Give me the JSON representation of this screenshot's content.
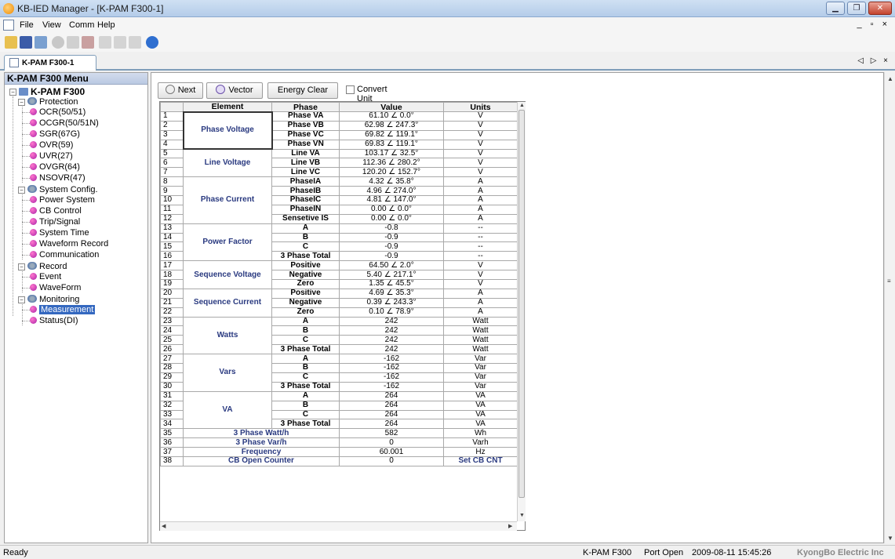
{
  "window": {
    "title": "KB-IED Manager - [K-PAM F300-1]"
  },
  "menu": {
    "items": [
      "File",
      "View",
      "Comm",
      "Help"
    ]
  },
  "tab": {
    "label": "K-PAM F300-1"
  },
  "left": {
    "header": "K-PAM F300 Menu",
    "root": "K-PAM F300",
    "groups": [
      {
        "label": "Protection",
        "items": [
          "OCR(50/51)",
          "OCGR(50/51N)",
          "SGR(67G)",
          "OVR(59)",
          "UVR(27)",
          "OVGR(64)",
          "NSOVR(47)"
        ]
      },
      {
        "label": "System Config.",
        "items": [
          "Power System",
          "CB Control",
          "Trip/Signal",
          "System Time",
          "Waveform Record",
          "Communication"
        ]
      },
      {
        "label": "Record",
        "items": [
          "Event",
          "WaveForm"
        ]
      },
      {
        "label": "Monitoring",
        "items": [
          "Measurement",
          "Status(DI)"
        ]
      }
    ]
  },
  "toolbar": {
    "next": "Next",
    "vector": "Vector",
    "energy_clear": "Energy Clear",
    "convert_unit": "Convert Unit"
  },
  "table": {
    "headers": [
      "Element",
      "Phase",
      "Value",
      "Units"
    ],
    "rows": [
      [
        "1",
        "",
        "Phase VA",
        "61.10 ∠ 0.0°",
        "V"
      ],
      [
        "2",
        "Phase Voltage",
        "Phase VB",
        "62.98 ∠ 247.3°",
        "V"
      ],
      [
        "3",
        "",
        "Phase VC",
        "69.82 ∠ 119.1°",
        "V"
      ],
      [
        "4",
        "",
        "Phase VN",
        "69.83 ∠ 119.1°",
        "V"
      ],
      [
        "5",
        "",
        "Line VA",
        "103.17 ∠ 32.5°",
        "V"
      ],
      [
        "6",
        "Line Voltage",
        "Line VB",
        "112.36 ∠ 280.2°",
        "V"
      ],
      [
        "7",
        "",
        "Line VC",
        "120.20 ∠ 152.7°",
        "V"
      ],
      [
        "8",
        "",
        "PhaseIA",
        "4.32 ∠ 35.8°",
        "A"
      ],
      [
        "9",
        "",
        "PhaseIB",
        "4.96 ∠ 274.0°",
        "A"
      ],
      [
        "10",
        "Phase Current",
        "PhaseIC",
        "4.81 ∠ 147.0°",
        "A"
      ],
      [
        "11",
        "",
        "PhaseIN",
        "0.00 ∠ 0.0°",
        "A"
      ],
      [
        "12",
        "",
        "Sensetive IS",
        "0.00 ∠ 0.0°",
        "A"
      ],
      [
        "13",
        "",
        "A",
        "-0.8",
        "--"
      ],
      [
        "14",
        "Power Factor",
        "B",
        "-0.9",
        "--"
      ],
      [
        "15",
        "",
        "C",
        "-0.9",
        "--"
      ],
      [
        "16",
        "",
        "3 Phase Total",
        "-0.9",
        "--"
      ],
      [
        "17",
        "",
        "Positive",
        "64.50 ∠ 2.0°",
        "V"
      ],
      [
        "18",
        "Sequence Voltage",
        "Negative",
        "5.40 ∠ 217.1°",
        "V"
      ],
      [
        "19",
        "",
        "Zero",
        "1.35 ∠ 45.5°",
        "V"
      ],
      [
        "20",
        "",
        "Positive",
        "4.69 ∠ 35.3°",
        "A"
      ],
      [
        "21",
        "Sequence Current",
        "Negative",
        "0.39 ∠ 243.3°",
        "A"
      ],
      [
        "22",
        "",
        "Zero",
        "0.10 ∠ 78.9°",
        "A"
      ],
      [
        "23",
        "",
        "A",
        "242",
        "Watt"
      ],
      [
        "24",
        "Watts",
        "B",
        "242",
        "Watt"
      ],
      [
        "25",
        "",
        "C",
        "242",
        "Watt"
      ],
      [
        "26",
        "",
        "3 Phase Total",
        "242",
        "Watt"
      ],
      [
        "27",
        "",
        "A",
        "-162",
        "Var"
      ],
      [
        "28",
        "Vars",
        "B",
        "-162",
        "Var"
      ],
      [
        "29",
        "",
        "C",
        "-162",
        "Var"
      ],
      [
        "30",
        "",
        "3 Phase Total",
        "-162",
        "Var"
      ],
      [
        "31",
        "",
        "A",
        "264",
        "VA"
      ],
      [
        "32",
        "VA",
        "B",
        "264",
        "VA"
      ],
      [
        "33",
        "",
        "C",
        "264",
        "VA"
      ],
      [
        "34",
        "",
        "3 Phase Total",
        "264",
        "VA"
      ],
      [
        "35",
        "3 Phase Watt/h",
        "",
        "582",
        "Wh"
      ],
      [
        "36",
        "3 Phase Var/h",
        "",
        "0",
        "Varh"
      ],
      [
        "37",
        "Frequency",
        "",
        "60.001",
        "Hz"
      ],
      [
        "38",
        "CB Open Counter",
        "",
        "0",
        "Set CB CNT"
      ]
    ]
  },
  "status": {
    "left": "Ready",
    "device": "K-PAM F300",
    "port": "Port Open",
    "datetime": "2009-08-11 15:45:26",
    "company": "KyongBo Electric Inc"
  }
}
